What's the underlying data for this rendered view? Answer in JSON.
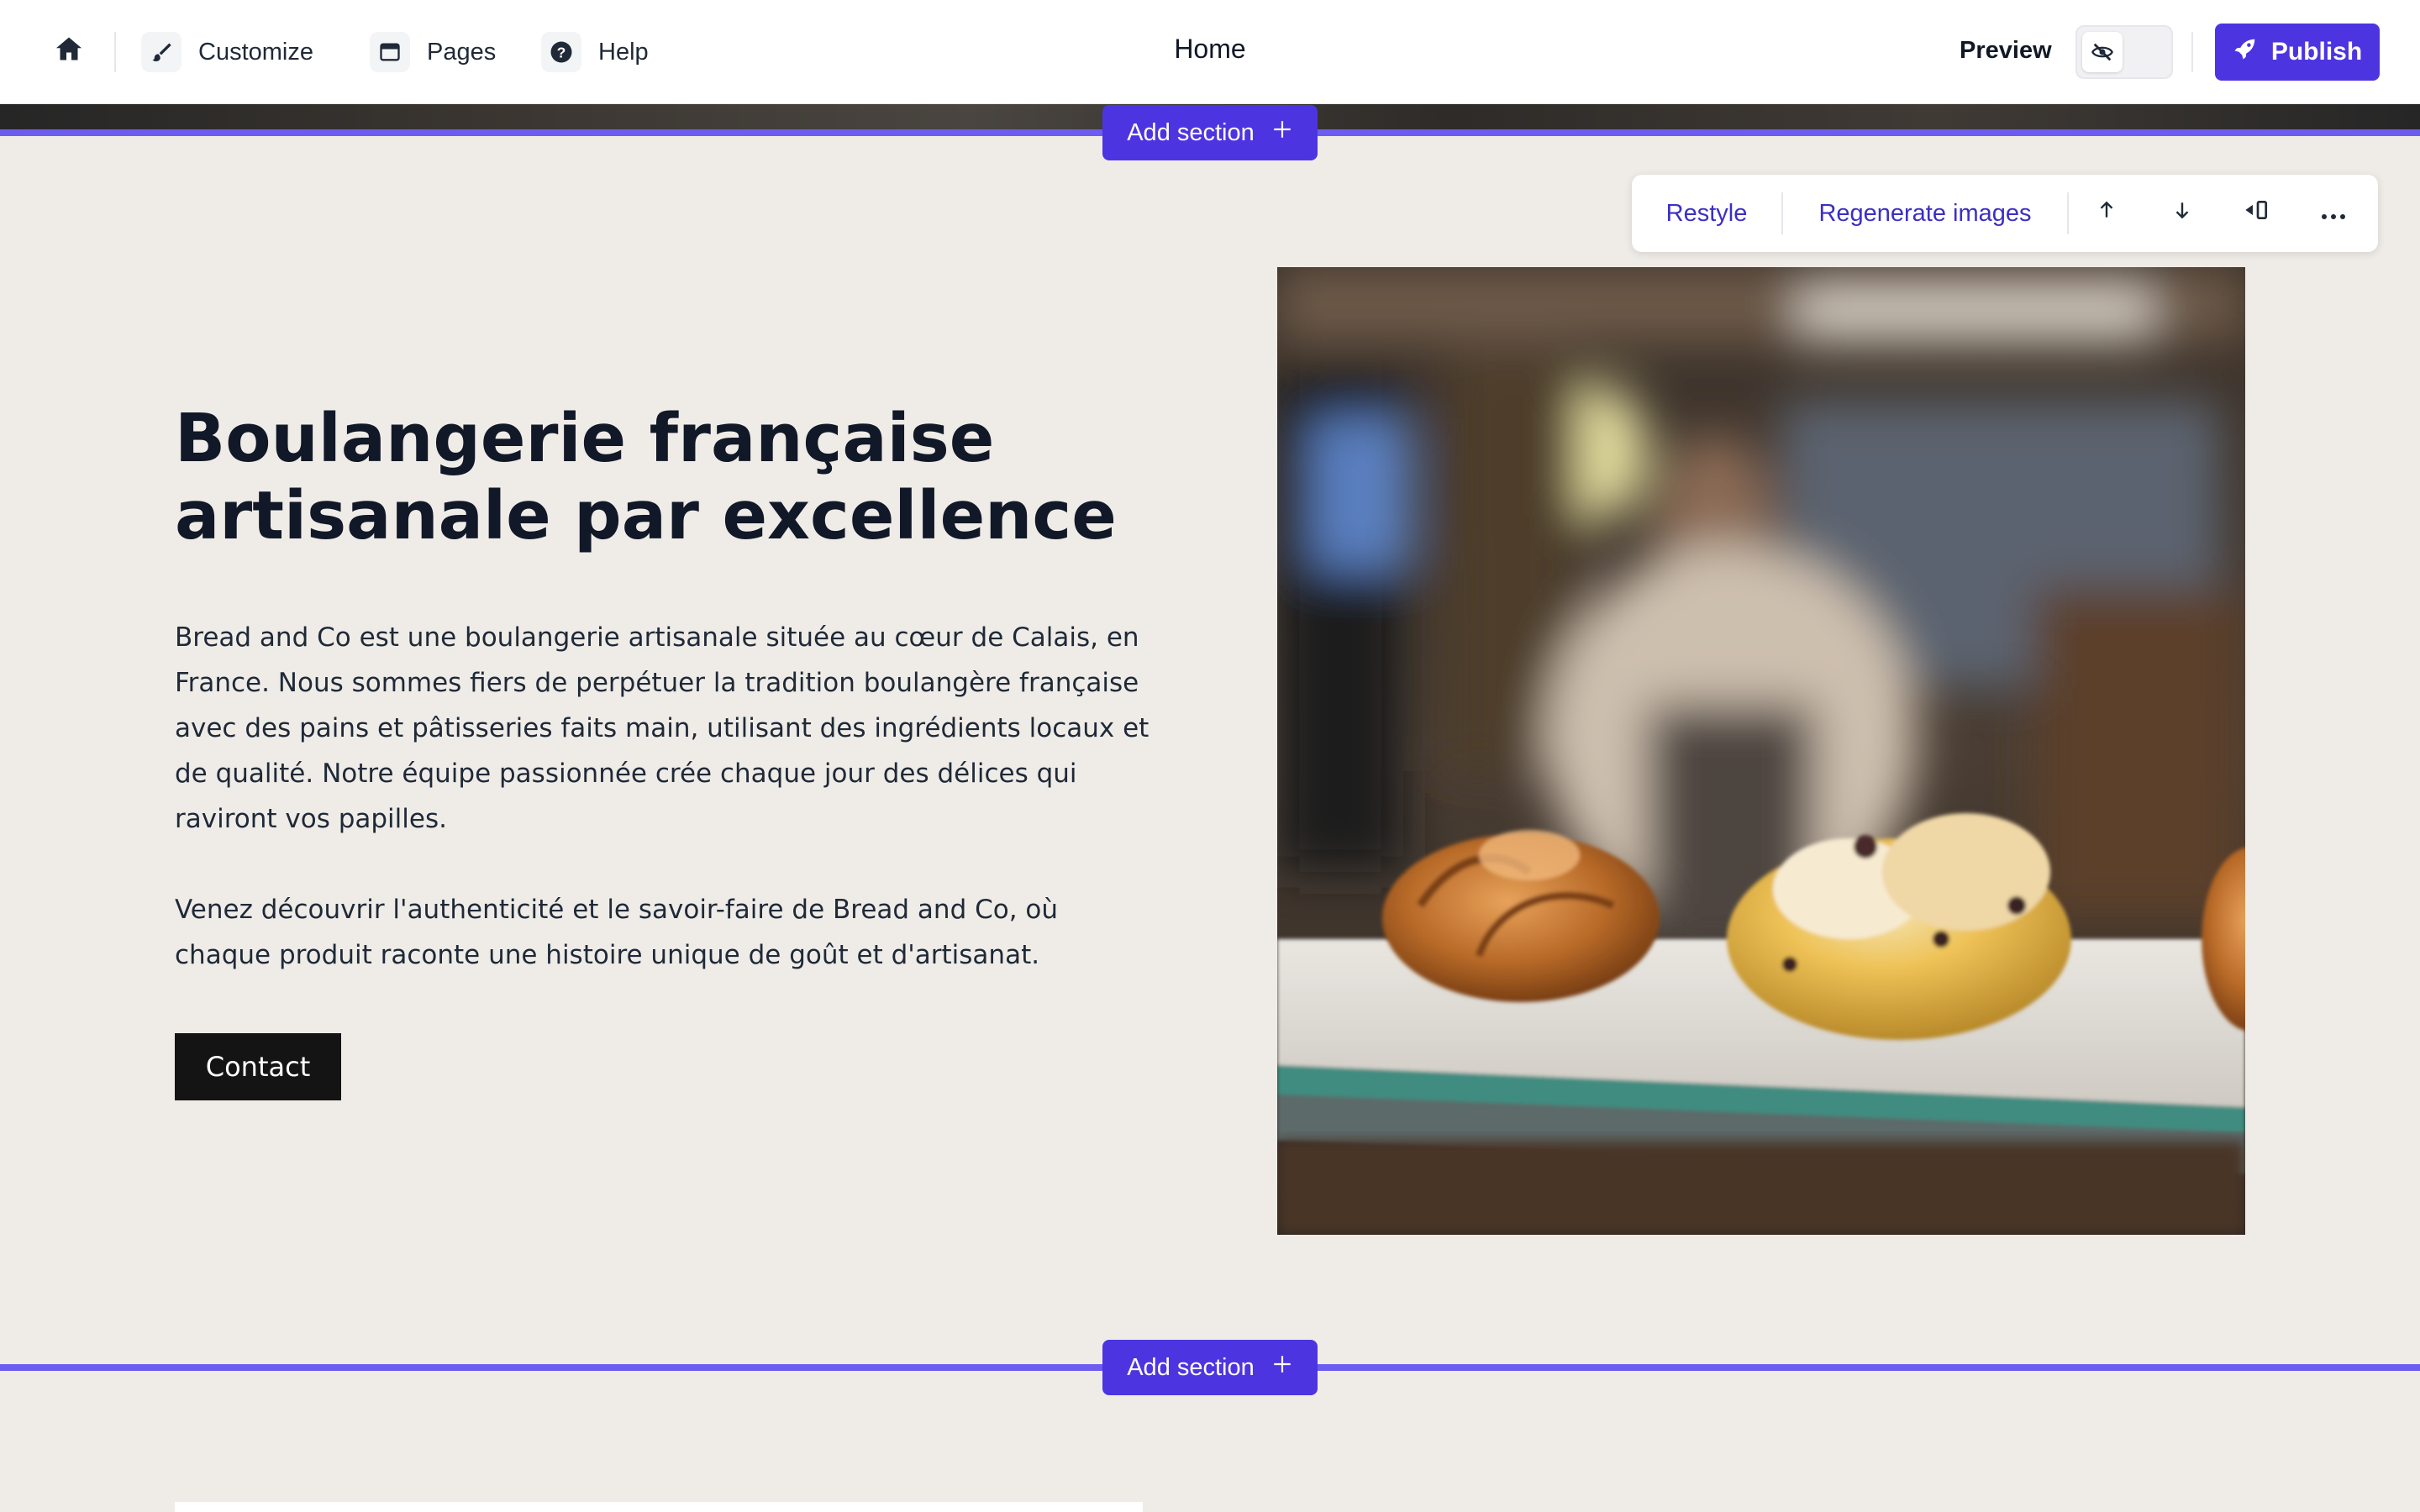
{
  "topbar": {
    "home_label": "",
    "customize_label": "Customize",
    "pages_label": "Pages",
    "help_label": "Help",
    "page_title": "Home",
    "preview_label": "Preview",
    "publish_label": "Publish"
  },
  "add_section_label": "Add section",
  "section_toolbar": {
    "restyle_label": "Restyle",
    "regenerate_label": "Regenerate images"
  },
  "hero": {
    "heading_line1": "Boulangerie française",
    "heading_line2": "artisanale par excellence",
    "para1": "Bread and Co est une boulangerie artisanale située au cœur de Calais, en France. Nous sommes fiers de perpétuer la tradition boulangère française avec des pains et pâtisseries faits main, utilisant des ingrédients locaux et de qualité. Notre équipe passionnée crée chaque jour des délices qui raviront vos papilles.",
    "para2": "Venez découvrir l'authenticité et le savoir-faire de Bread and Co, où chaque produit raconte une histoire unique de goût et d'artisanat.",
    "contact_label": "Contact"
  },
  "colors": {
    "accent": "#4c35e0",
    "guide_line": "#6d5cf0",
    "section_bg": "#efece8"
  },
  "icons": [
    "home-icon",
    "brush-icon",
    "pages-icon",
    "help-icon",
    "eye-off-icon",
    "rocket-icon",
    "plus-icon",
    "arrow-up-icon",
    "arrow-down-icon",
    "layout-icon",
    "more-icon"
  ]
}
